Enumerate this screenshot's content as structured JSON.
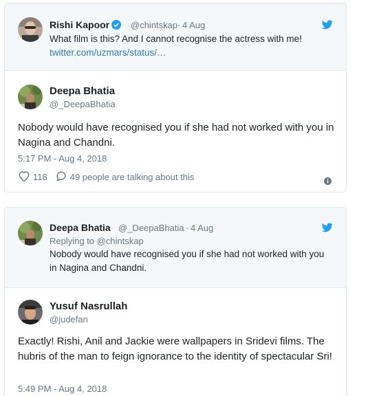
{
  "card1": {
    "quoted": {
      "name": "Rishi Kapoor",
      "handle": "@chintskap",
      "separator": "·",
      "date": "4 Aug",
      "text": "What film is this? And I cannot recognise the actress with me!",
      "link": "twitter.com/uzmars/status/…"
    },
    "tweet": {
      "name": "Deepa Bhatia",
      "handle": "@_DeepaBhatia",
      "text": "Nobody would have recognised you if she had not worked with you in Nagina and Chandni.",
      "timestamp": "5:17 PM - Aug 4, 2018",
      "likes": "118",
      "talking": "49 people are talking about this"
    }
  },
  "card2": {
    "quoted": {
      "name": "Deepa Bhatia",
      "handle": "@_DeepaBhatia",
      "separator": "·",
      "date": "4 Aug",
      "replying": "Replying to @chintskap",
      "text": "Nobody would have recognised you if she had not worked with you in Nagina and Chandni."
    },
    "tweet": {
      "name": "Yusuf Nasrullah",
      "handle": "@judefan",
      "text": "Exactly! Rishi, Anil and Jackie were wallpapers in Sridevi films. The hubris of the man to feign ignorance to the identity of spectacular Sri!",
      "timestamp": "5:49 PM - Aug 4, 2018"
    }
  },
  "colors": {
    "accent": "#1da1f2",
    "link": "#2b7bb9",
    "muted": "#697882",
    "quote_bg": "#f5f8fa",
    "border": "#e1e8ed"
  },
  "icons": [
    "verified-badge-icon",
    "twitter-bird-icon",
    "heart-icon",
    "reply-bubble-icon",
    "info-icon"
  ]
}
